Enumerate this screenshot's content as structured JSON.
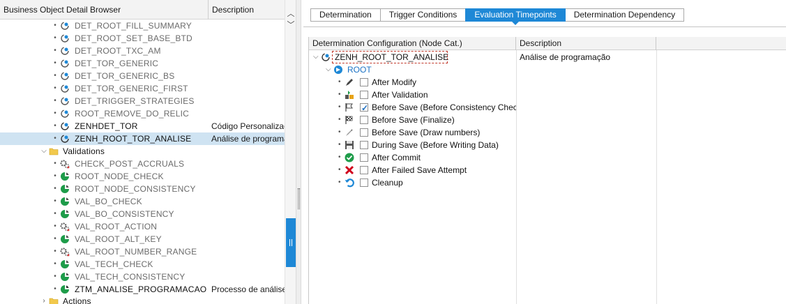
{
  "left": {
    "header": {
      "col1": "Business Object Detail Browser",
      "col2": "Description"
    },
    "rows": [
      {
        "label": "DET_ROOT_FILL_SUMMARY",
        "desc": ""
      },
      {
        "label": "DET_ROOT_SET_BASE_BTD",
        "desc": ""
      },
      {
        "label": "DET_ROOT_TXC_AM",
        "desc": ""
      },
      {
        "label": "DET_TOR_GENERIC",
        "desc": ""
      },
      {
        "label": "DET_TOR_GENERIC_BS",
        "desc": ""
      },
      {
        "label": "DET_TOR_GENERIC_FIRST",
        "desc": ""
      },
      {
        "label": "DET_TRIGGER_STRATEGIES",
        "desc": ""
      },
      {
        "label": "ROOT_REMOVE_DO_RELIC",
        "desc": ""
      },
      {
        "label": "ZENHDET_TOR",
        "desc": "Código Personalizado"
      },
      {
        "label": "ZENH_ROOT_TOR_ANALISE",
        "desc": "Análise de programação"
      },
      {
        "label": "Validations",
        "desc": ""
      },
      {
        "label": "CHECK_POST_ACCRUALS",
        "desc": ""
      },
      {
        "label": "ROOT_NODE_CHECK",
        "desc": ""
      },
      {
        "label": "ROOT_NODE_CONSISTENCY",
        "desc": ""
      },
      {
        "label": "VAL_BO_CHECK",
        "desc": ""
      },
      {
        "label": "VAL_BO_CONSISTENCY",
        "desc": ""
      },
      {
        "label": "VAL_ROOT_ACTION",
        "desc": ""
      },
      {
        "label": "VAL_ROOT_ALT_KEY",
        "desc": ""
      },
      {
        "label": "VAL_ROOT_NUMBER_RANGE",
        "desc": ""
      },
      {
        "label": "VAL_TECH_CHECK",
        "desc": ""
      },
      {
        "label": "VAL_TECH_CONSISTENCY",
        "desc": ""
      },
      {
        "label": "ZTM_ANALISE_PROGRAMACAO",
        "desc": "Processo de análise"
      },
      {
        "label": "Actions",
        "desc": ""
      }
    ]
  },
  "tabs": [
    {
      "label": "Determination"
    },
    {
      "label": "Trigger Conditions"
    },
    {
      "label": "Evaluation Timepoints"
    },
    {
      "label": "Determination Dependency"
    }
  ],
  "grid": {
    "header": {
      "col1": "Determination Configuration (Node Cat.)",
      "col2": "Description",
      "col3": ""
    },
    "determination": {
      "label": "ZENH_ROOT_TOR_ANALISE",
      "desc": "Análise de programação"
    },
    "node": {
      "label": "ROOT"
    },
    "timepoints": [
      {
        "label": "After Modify",
        "checked": false,
        "icon": "pencil-icon"
      },
      {
        "label": "After Validation",
        "checked": false,
        "icon": "validation-icon"
      },
      {
        "label": "Before Save (Before Consistency Check)",
        "checked": true,
        "icon": "flag-icon"
      },
      {
        "label": "Before Save (Finalize)",
        "checked": false,
        "icon": "checkered-flag-icon"
      },
      {
        "label": "Before Save (Draw numbers)",
        "checked": false,
        "icon": "pen-icon"
      },
      {
        "label": "During Save (Before Writing Data)",
        "checked": false,
        "icon": "save-icon"
      },
      {
        "label": "After Commit",
        "checked": false,
        "icon": "green-check-icon"
      },
      {
        "label": "After Failed Save Attempt",
        "checked": false,
        "icon": "red-x-icon"
      },
      {
        "label": "Cleanup",
        "checked": false,
        "icon": "undo-icon"
      }
    ]
  },
  "colors": {
    "accent": "#1e88d6",
    "selected_row": "#cfe3f2"
  }
}
